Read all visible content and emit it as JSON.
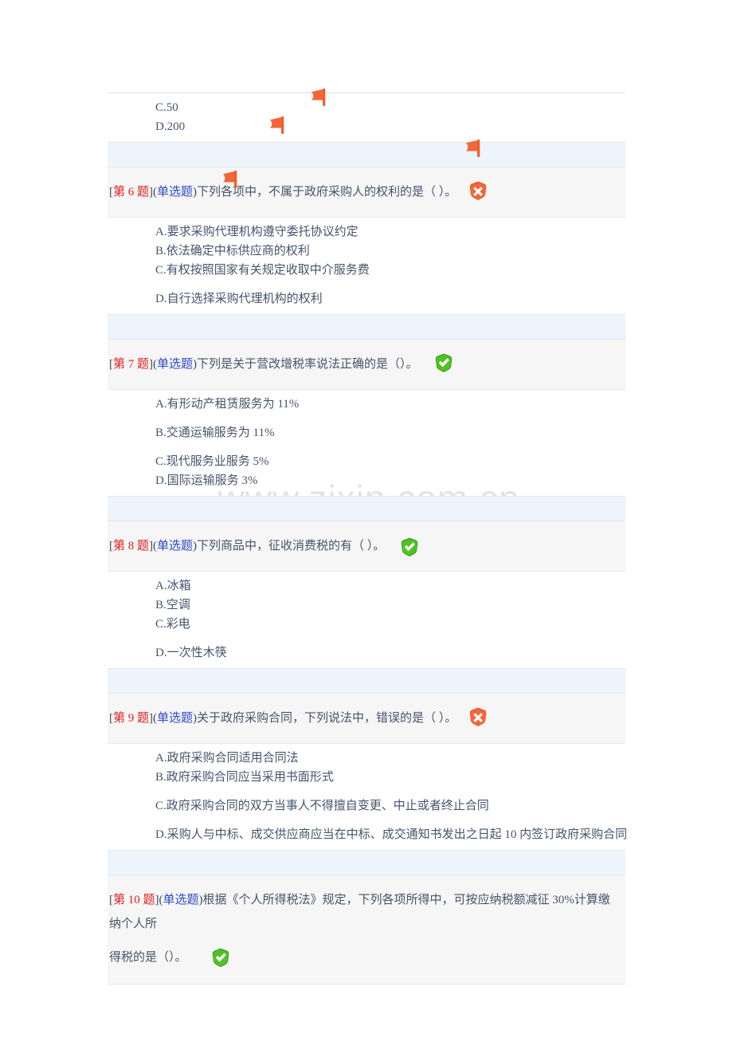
{
  "watermark": "www.zixin.com.cn",
  "colors": {
    "band": "#edf4fc",
    "question_row": "#f6f6f6",
    "question_number": "#e02020",
    "question_type": "#2f48c8",
    "body_text": "#46546b",
    "flag": "#f4663a",
    "badge_correct": "#3fae28",
    "badge_wrong": "#ef5223",
    "watermark": "#e3e3e3"
  },
  "icons": {
    "correct": "green-shield-check-icon",
    "wrong": "red-shield-cross-icon",
    "marker": "orange-flag-icon"
  },
  "labels": {
    "bracket_open": "[",
    "bracket_close": "]",
    "type_open": "(",
    "type_close": ")"
  },
  "continued_options": [
    {
      "id": "C",
      "text": "C.50"
    },
    {
      "id": "D",
      "text": "D.200"
    }
  ],
  "questions": [
    {
      "number": "第 6 题",
      "type": "单选题",
      "stem": "下列各项中，不属于政府采购人的权利的是（ ）。",
      "result": "wrong",
      "flagged_option": "D",
      "options": [
        {
          "id": "A",
          "text": "A.要求采购代理机构遵守委托协议约定",
          "spaced": false
        },
        {
          "id": "B",
          "text": "B.依法确定中标供应商的权利",
          "spaced": false
        },
        {
          "id": "C",
          "text": "C.有权按照国家有关规定收取中介服务费",
          "spaced": false
        },
        {
          "id": "D",
          "text": "D.自行选择采购代理机构的权利",
          "spaced": true
        }
      ]
    },
    {
      "number": "第 7 题",
      "type": "单选题",
      "stem": "下列是关于营改增税率说法正确的是（）。",
      "result": "correct",
      "flagged_option": "B",
      "options": [
        {
          "id": "A",
          "text": "A.有形动产租赁服务为 11%",
          "spaced": false
        },
        {
          "id": "B",
          "text": "B.交通运输服务为 11%",
          "spaced": true
        },
        {
          "id": "C",
          "text": "C.现代服务业服务 5%",
          "spaced": true
        },
        {
          "id": "D",
          "text": "D.国际运输服务 3%",
          "spaced": false
        }
      ]
    },
    {
      "number": "第 8 题",
      "type": "单选题",
      "stem": "下列商品中，征收消费税的有（  ）。",
      "result": "correct",
      "flagged_option": "D",
      "options": [
        {
          "id": "A",
          "text": "A.冰箱",
          "spaced": false
        },
        {
          "id": "B",
          "text": "B.空调",
          "spaced": false
        },
        {
          "id": "C",
          "text": "C.彩电",
          "spaced": false
        },
        {
          "id": "D",
          "text": "D.一次性木筷",
          "spaced": true
        }
      ]
    },
    {
      "number": "第 9 题",
      "type": "单选题",
      "stem": "关于政府采购合同，下列说法中，错误的是（ ）。",
      "result": "wrong",
      "flagged_option": "C",
      "options": [
        {
          "id": "A",
          "text": "A.政府采购合同适用合同法",
          "spaced": false
        },
        {
          "id": "B",
          "text": "B.政府采购合同应当采用书面形式",
          "spaced": false
        },
        {
          "id": "C",
          "text": "C.政府采购合同的双方当事人不得擅自变更、中止或者终止合同",
          "spaced": true
        },
        {
          "id": "D",
          "text": "D.采购人与中标、成交供应商应当在中标、成交通知书发出之日起 10 内签订政府采购合同",
          "spaced": true
        }
      ]
    },
    {
      "number": "第 10 题",
      "type": "单选题",
      "stem_line1": "根据《个人所得税法》规定，下列各项所得中，可按应纳税额减征 30%计算缴纳个人所",
      "stem_line2": "得税的是（）。",
      "result": "correct",
      "options": []
    }
  ]
}
